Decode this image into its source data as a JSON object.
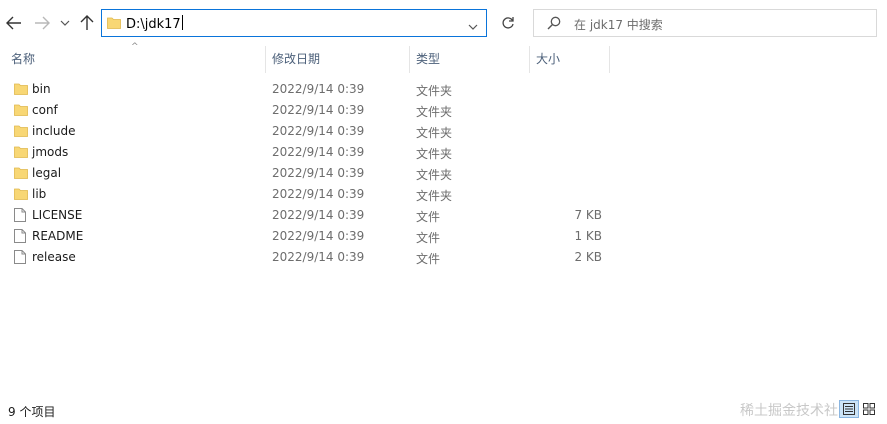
{
  "address": {
    "path": "D:\\jdk17"
  },
  "search": {
    "placeholder": "在 jdk17 中搜索"
  },
  "columns": {
    "name": "名称",
    "date": "修改日期",
    "type": "类型",
    "size": "大小"
  },
  "files": [
    {
      "name": "bin",
      "date": "2022/9/14 0:39",
      "type": "文件夹",
      "size": "",
      "icon": "folder-icon"
    },
    {
      "name": "conf",
      "date": "2022/9/14 0:39",
      "type": "文件夹",
      "size": "",
      "icon": "folder-icon"
    },
    {
      "name": "include",
      "date": "2022/9/14 0:39",
      "type": "文件夹",
      "size": "",
      "icon": "folder-icon"
    },
    {
      "name": "jmods",
      "date": "2022/9/14 0:39",
      "type": "文件夹",
      "size": "",
      "icon": "folder-icon"
    },
    {
      "name": "legal",
      "date": "2022/9/14 0:39",
      "type": "文件夹",
      "size": "",
      "icon": "folder-icon"
    },
    {
      "name": "lib",
      "date": "2022/9/14 0:39",
      "type": "文件夹",
      "size": "",
      "icon": "folder-icon"
    },
    {
      "name": "LICENSE",
      "date": "2022/9/14 0:39",
      "type": "文件",
      "size": "7 KB",
      "icon": "file-icon"
    },
    {
      "name": "README",
      "date": "2022/9/14 0:39",
      "type": "文件",
      "size": "1 KB",
      "icon": "file-icon"
    },
    {
      "name": "release",
      "date": "2022/9/14 0:39",
      "type": "文件",
      "size": "2 KB",
      "icon": "file-icon"
    }
  ],
  "status": {
    "count": "9 个项目"
  },
  "watermark": "稀土掘金技术社区",
  "colors": {
    "accent": "#0a74da",
    "folder": "#f8d775",
    "header_text": "#4c607a"
  }
}
